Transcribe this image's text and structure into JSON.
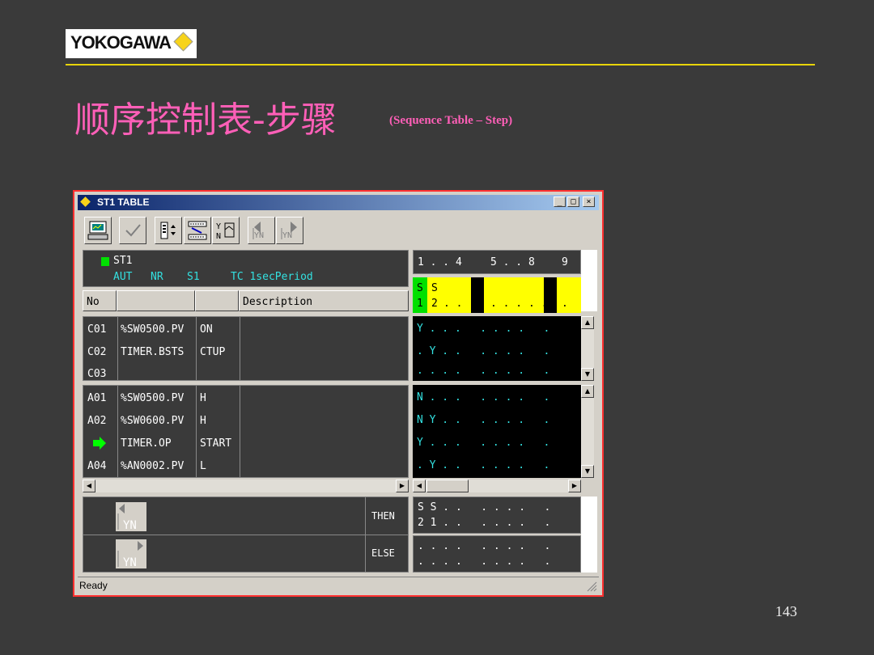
{
  "slide": {
    "logo_text": "YOKOGAWA",
    "title": "顺序控制表-步骤",
    "subtitle": "(Sequence Table – Step)",
    "page_number": "143"
  },
  "window": {
    "title": "ST1 TABLE",
    "status": "Ready",
    "controls": {
      "minimize": "_",
      "maximize": "□",
      "close": "×"
    }
  },
  "toolbar": {
    "buttons": [
      "monitor-icon",
      "check-icon",
      "step-select-icon",
      "flow-icon",
      "yn-branch-icon",
      "prev-yn-icon",
      "next-yn-icon"
    ],
    "prev_label": "YN",
    "next_label": "YN"
  },
  "header": {
    "tag": "ST1",
    "mode": "AUT",
    "alarm": "NR",
    "step": "S1",
    "timing": "TC 1secPeriod",
    "status_color": "#00e000"
  },
  "columns": {
    "no": "No",
    "description": "Description"
  },
  "rule_numbers": {
    "g1": "1 . . 4",
    "g2": "5 . . 8",
    "g3": "9"
  },
  "step_row": {
    "s_row": [
      "S",
      "S"
    ],
    "num_row": [
      "1",
      "2"
    ]
  },
  "conditions": [
    {
      "no": "C01",
      "tag": "%SW0500.PV",
      "action": "ON",
      "rules": "Y . . .   . . . .   ."
    },
    {
      "no": "C02",
      "tag": "TIMER.BSTS",
      "action": "CTUP",
      "rules": ". Y . .   . . . .   ."
    },
    {
      "no": "C03",
      "tag": "",
      "action": "",
      "rules": ". . . .   . . . .   ."
    }
  ],
  "actions": [
    {
      "no": "A01",
      "tag": "%SW0500.PV",
      "action": "H",
      "rules": "N . . .   . . . .   ."
    },
    {
      "no": "A02",
      "tag": "%SW0600.PV",
      "action": "H",
      "rules": "N Y . .   . . . .   ."
    },
    {
      "no": "",
      "tag": "TIMER.OP",
      "action": "START",
      "rules": "Y . . .   . . . .   ."
    },
    {
      "no": "A04",
      "tag": "%AN0002.PV",
      "action": "L",
      "rules": ". Y . .   . . . .   ."
    }
  ],
  "then_else": {
    "then_label": "THEN",
    "else_label": "ELSE",
    "then_rows": [
      "S S . .   . . . .   .",
      "2 1 . .   . . . .   ."
    ],
    "else_rows": [
      ". . . .   . . . .   .",
      ". . . .   . . . .   ."
    ],
    "yn_label": "YN"
  },
  "colors": {
    "step_active": "#00e000",
    "step_yellow": "#ffff00",
    "rule_text": "#33e0e0",
    "title_pink": "#ff5fb8",
    "accent_line": "#e8d40a",
    "arrow_green": "#00ff00"
  }
}
